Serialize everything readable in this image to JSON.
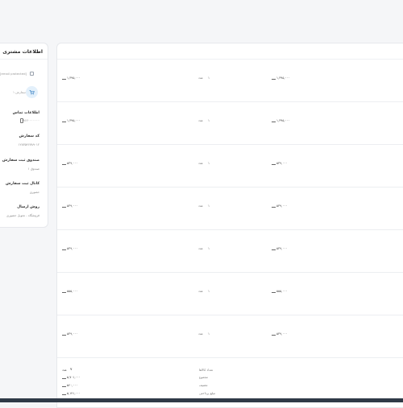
{
  "customer": {
    "title": "اطلاعات مشتری",
    "email": "[email protected]",
    "orders_count": "۱ سفارش",
    "contact_label": "اطلاعات تماس",
    "contact_phone": "۰۹۱۲۰۰۰۰۰۰۰",
    "order_code_label": "کد سفارش",
    "order_code": "۱۲۸۳۵۴۶۷۸۹۰۱۲",
    "cash_box_label": "صندوق ثبت سفارش",
    "cash_box_value": "صندوق ۱",
    "channel_label": "کانال ثبت سفارش",
    "channel_value": "حضوری",
    "shipping_label": "روش ارسال",
    "shipping_value": "فروشگاه - تحویل حضوری"
  },
  "products": [
    {
      "total": "۱,۳۹۵,۰۰۰",
      "qty_unit": "عدد",
      "qty": "۱",
      "price": "۱,۳۹۵,۰۰۰"
    },
    {
      "total": "۱,۳۹۵,۰۰۰",
      "qty_unit": "عدد",
      "qty": "۱",
      "price": "۱,۳۹۵,۰۰۰"
    },
    {
      "total": "۵۳۹,۰۰۰",
      "qty_unit": "عدد",
      "qty": "۱",
      "price": "۵۳۹,۰۰۰"
    },
    {
      "total": "۵۳۹,۰۰۰",
      "qty_unit": "عدد",
      "qty": "۱",
      "price": "۵۳۹,۰۰۰"
    },
    {
      "total": "۵۳۹,۰۰۰",
      "qty_unit": "عدد",
      "qty": "۱",
      "price": "۵۳۹,۰۰۰"
    },
    {
      "total": "۵۵۵,۰۰۰",
      "qty_unit": "عدد",
      "qty": "۱",
      "price": "۵۵۵,۰۰۰"
    },
    {
      "total": "۵۳۹,۰۰۰",
      "qty_unit": "عدد",
      "qty": "۱",
      "price": "۵۳۹,۰۰۰"
    }
  ],
  "summary": {
    "count_label": "تعداد کالاها",
    "count_value": "۷",
    "count_unit": "عدد",
    "subtotal_label": "مجموع",
    "subtotal_value": "۵,۷۰۱,۰۰۰",
    "discount_label": "تخفیف",
    "discount_value": "۵۶۰,۰۰۰",
    "payable_label": "مبلغ پرداختی",
    "payable_value": "۵,۱۴۱,۰۰۰"
  }
}
